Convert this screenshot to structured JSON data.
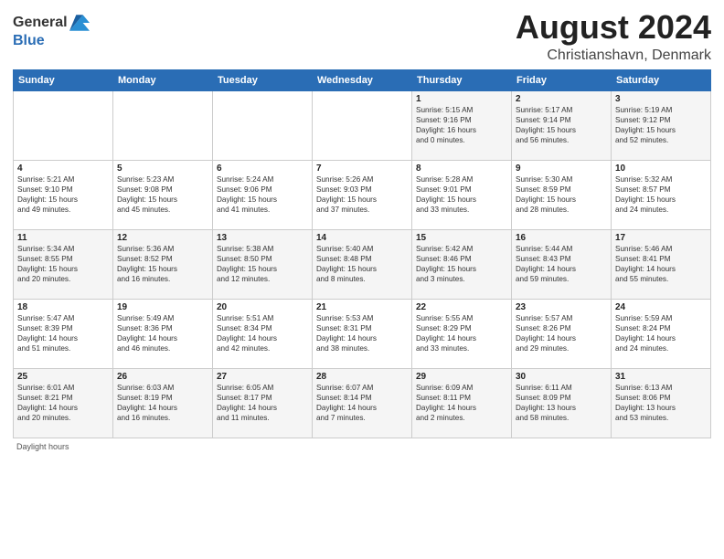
{
  "logo": {
    "general": "General",
    "blue": "Blue"
  },
  "header": {
    "month": "August 2024",
    "location": "Christianshavn, Denmark"
  },
  "days_of_week": [
    "Sunday",
    "Monday",
    "Tuesday",
    "Wednesday",
    "Thursday",
    "Friday",
    "Saturday"
  ],
  "weeks": [
    [
      {
        "day": "",
        "info": ""
      },
      {
        "day": "",
        "info": ""
      },
      {
        "day": "",
        "info": ""
      },
      {
        "day": "",
        "info": ""
      },
      {
        "day": "1",
        "info": "Sunrise: 5:15 AM\nSunset: 9:16 PM\nDaylight: 16 hours\nand 0 minutes."
      },
      {
        "day": "2",
        "info": "Sunrise: 5:17 AM\nSunset: 9:14 PM\nDaylight: 15 hours\nand 56 minutes."
      },
      {
        "day": "3",
        "info": "Sunrise: 5:19 AM\nSunset: 9:12 PM\nDaylight: 15 hours\nand 52 minutes."
      }
    ],
    [
      {
        "day": "4",
        "info": "Sunrise: 5:21 AM\nSunset: 9:10 PM\nDaylight: 15 hours\nand 49 minutes."
      },
      {
        "day": "5",
        "info": "Sunrise: 5:23 AM\nSunset: 9:08 PM\nDaylight: 15 hours\nand 45 minutes."
      },
      {
        "day": "6",
        "info": "Sunrise: 5:24 AM\nSunset: 9:06 PM\nDaylight: 15 hours\nand 41 minutes."
      },
      {
        "day": "7",
        "info": "Sunrise: 5:26 AM\nSunset: 9:03 PM\nDaylight: 15 hours\nand 37 minutes."
      },
      {
        "day": "8",
        "info": "Sunrise: 5:28 AM\nSunset: 9:01 PM\nDaylight: 15 hours\nand 33 minutes."
      },
      {
        "day": "9",
        "info": "Sunrise: 5:30 AM\nSunset: 8:59 PM\nDaylight: 15 hours\nand 28 minutes."
      },
      {
        "day": "10",
        "info": "Sunrise: 5:32 AM\nSunset: 8:57 PM\nDaylight: 15 hours\nand 24 minutes."
      }
    ],
    [
      {
        "day": "11",
        "info": "Sunrise: 5:34 AM\nSunset: 8:55 PM\nDaylight: 15 hours\nand 20 minutes."
      },
      {
        "day": "12",
        "info": "Sunrise: 5:36 AM\nSunset: 8:52 PM\nDaylight: 15 hours\nand 16 minutes."
      },
      {
        "day": "13",
        "info": "Sunrise: 5:38 AM\nSunset: 8:50 PM\nDaylight: 15 hours\nand 12 minutes."
      },
      {
        "day": "14",
        "info": "Sunrise: 5:40 AM\nSunset: 8:48 PM\nDaylight: 15 hours\nand 8 minutes."
      },
      {
        "day": "15",
        "info": "Sunrise: 5:42 AM\nSunset: 8:46 PM\nDaylight: 15 hours\nand 3 minutes."
      },
      {
        "day": "16",
        "info": "Sunrise: 5:44 AM\nSunset: 8:43 PM\nDaylight: 14 hours\nand 59 minutes."
      },
      {
        "day": "17",
        "info": "Sunrise: 5:46 AM\nSunset: 8:41 PM\nDaylight: 14 hours\nand 55 minutes."
      }
    ],
    [
      {
        "day": "18",
        "info": "Sunrise: 5:47 AM\nSunset: 8:39 PM\nDaylight: 14 hours\nand 51 minutes."
      },
      {
        "day": "19",
        "info": "Sunrise: 5:49 AM\nSunset: 8:36 PM\nDaylight: 14 hours\nand 46 minutes."
      },
      {
        "day": "20",
        "info": "Sunrise: 5:51 AM\nSunset: 8:34 PM\nDaylight: 14 hours\nand 42 minutes."
      },
      {
        "day": "21",
        "info": "Sunrise: 5:53 AM\nSunset: 8:31 PM\nDaylight: 14 hours\nand 38 minutes."
      },
      {
        "day": "22",
        "info": "Sunrise: 5:55 AM\nSunset: 8:29 PM\nDaylight: 14 hours\nand 33 minutes."
      },
      {
        "day": "23",
        "info": "Sunrise: 5:57 AM\nSunset: 8:26 PM\nDaylight: 14 hours\nand 29 minutes."
      },
      {
        "day": "24",
        "info": "Sunrise: 5:59 AM\nSunset: 8:24 PM\nDaylight: 14 hours\nand 24 minutes."
      }
    ],
    [
      {
        "day": "25",
        "info": "Sunrise: 6:01 AM\nSunset: 8:21 PM\nDaylight: 14 hours\nand 20 minutes."
      },
      {
        "day": "26",
        "info": "Sunrise: 6:03 AM\nSunset: 8:19 PM\nDaylight: 14 hours\nand 16 minutes."
      },
      {
        "day": "27",
        "info": "Sunrise: 6:05 AM\nSunset: 8:17 PM\nDaylight: 14 hours\nand 11 minutes."
      },
      {
        "day": "28",
        "info": "Sunrise: 6:07 AM\nSunset: 8:14 PM\nDaylight: 14 hours\nand 7 minutes."
      },
      {
        "day": "29",
        "info": "Sunrise: 6:09 AM\nSunset: 8:11 PM\nDaylight: 14 hours\nand 2 minutes."
      },
      {
        "day": "30",
        "info": "Sunrise: 6:11 AM\nSunset: 8:09 PM\nDaylight: 13 hours\nand 58 minutes."
      },
      {
        "day": "31",
        "info": "Sunrise: 6:13 AM\nSunset: 8:06 PM\nDaylight: 13 hours\nand 53 minutes."
      }
    ]
  ],
  "footer": {
    "note": "Daylight hours"
  }
}
